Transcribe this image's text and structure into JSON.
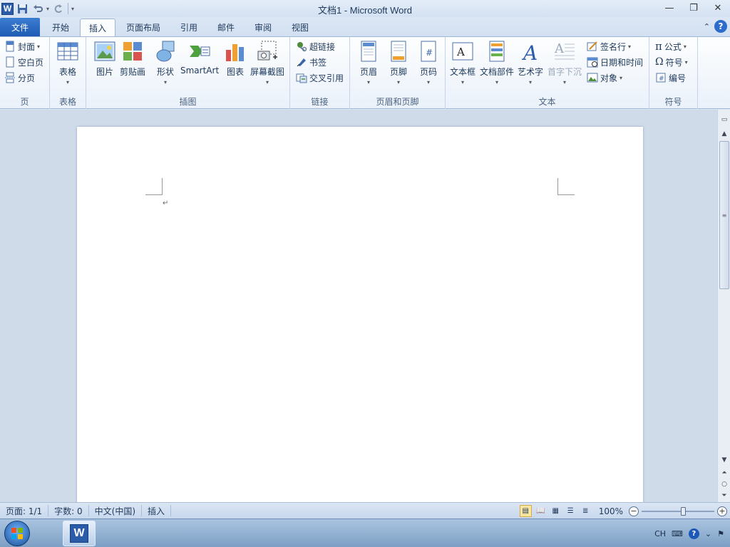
{
  "window": {
    "title": "文档1 - Microsoft Word",
    "app_icon_letter": "W"
  },
  "tabs": [
    {
      "label": "文件"
    },
    {
      "label": "开始"
    },
    {
      "label": "插入"
    },
    {
      "label": "页面布局"
    },
    {
      "label": "引用"
    },
    {
      "label": "邮件"
    },
    {
      "label": "审阅"
    },
    {
      "label": "视图"
    }
  ],
  "active_tab": "插入",
  "ribbon": {
    "pages": {
      "label": "页",
      "cover": "封面",
      "blank": "空白页",
      "break": "分页"
    },
    "tables": {
      "label": "表格",
      "table": "表格"
    },
    "illustrations": {
      "label": "插图",
      "picture": "图片",
      "clipart": "剪贴画",
      "shapes": "形状",
      "smartart": "SmartArt",
      "chart": "图表",
      "screenshot": "屏幕截图"
    },
    "links": {
      "label": "链接",
      "hyperlink": "超链接",
      "bookmark": "书签",
      "crossref": "交叉引用"
    },
    "header_footer": {
      "label": "页眉和页脚",
      "header": "页眉",
      "footer": "页脚",
      "page_number": "页码"
    },
    "text": {
      "label": "文本",
      "textbox": "文本框",
      "quickparts": "文档部件",
      "wordart": "艺术字",
      "dropcap": "首字下沉",
      "signature": "签名行",
      "datetime": "日期和时间",
      "object": "对象"
    },
    "symbols": {
      "label": "符号",
      "equation": "公式",
      "symbol": "符号",
      "number": "编号"
    }
  },
  "document": {
    "paragraph_mark": "↵"
  },
  "statusbar": {
    "page": "页面: 1/1",
    "words": "字数: 0",
    "language": "中文(中国)",
    "mode": "插入",
    "zoom": "100%",
    "zoom_minus": "−",
    "zoom_plus": "+"
  },
  "taskbar": {
    "ime": "CH"
  },
  "colors": {
    "file_tab": "#2a64bd",
    "ribbon_bg": "#f4f8fc",
    "accent": "#2d6ccb"
  }
}
